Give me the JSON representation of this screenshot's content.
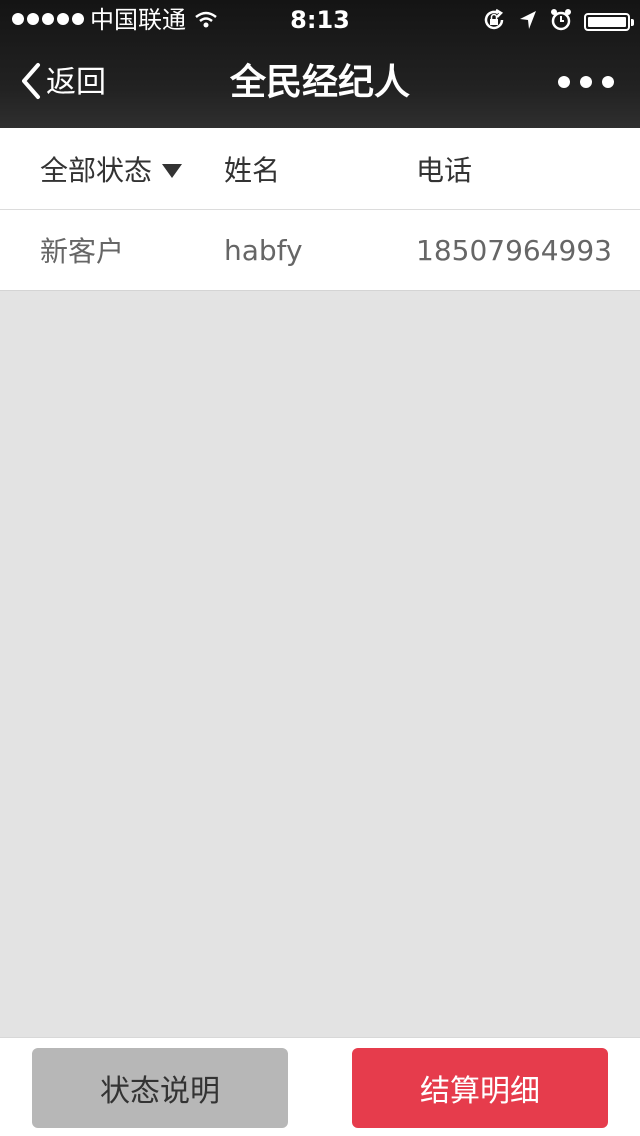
{
  "status_bar": {
    "carrier": "中国联通",
    "time": "8:13",
    "battery_level": 1.0
  },
  "nav": {
    "back_label": "返回",
    "title": "全民经纪人",
    "more_icon": "more-dots-icon"
  },
  "table": {
    "headers": {
      "status_filter": "全部状态",
      "name": "姓名",
      "phone": "电话"
    },
    "rows": [
      {
        "status": "新客户",
        "name": "habfy",
        "phone": "18507964993"
      }
    ]
  },
  "footer": {
    "status_explain_label": "状态说明",
    "settlement_label": "结算明细"
  },
  "colors": {
    "nav_bg": "#1c1c1c",
    "accent_red": "#e63c4c",
    "secondary_gray": "#b7b7b7",
    "page_bg": "#e3e3e3"
  }
}
